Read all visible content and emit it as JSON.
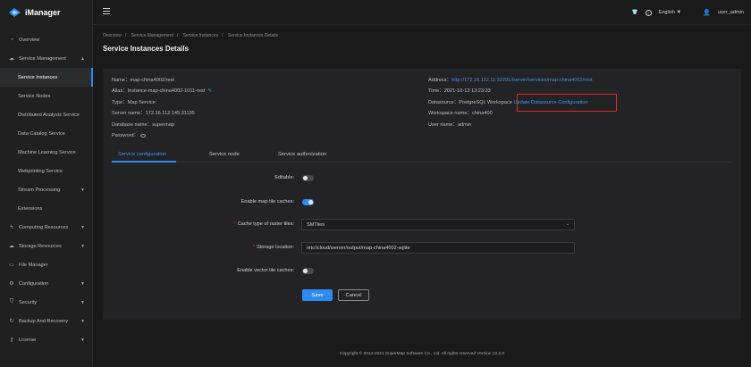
{
  "app": {
    "name": "iManager",
    "brand_color": "#2d8cf0"
  },
  "sidebar": {
    "items": [
      {
        "label": "Overview",
        "icon": "gauge-icon"
      },
      {
        "label": "Service Management",
        "icon": "cloud-icon",
        "expanded": true
      },
      {
        "label": "Service Instances",
        "sub": true,
        "active": true
      },
      {
        "label": "Service Nodes",
        "sub": true
      },
      {
        "label": "Distributed Analysis Service",
        "sub": true
      },
      {
        "label": "Data Catalog Service",
        "sub": true
      },
      {
        "label": "Machine Learning Service",
        "sub": true
      },
      {
        "label": "Webprinting Service",
        "sub": true
      },
      {
        "label": "Stream Processing",
        "sub": true,
        "has_children": true
      },
      {
        "label": "Extensions",
        "sub": true
      },
      {
        "label": "Computing Resources",
        "icon": "bolt-icon",
        "has_children": true
      },
      {
        "label": "Storage Resources",
        "icon": "cloud-icon",
        "has_children": true
      },
      {
        "label": "File Manager",
        "icon": "folder-icon"
      },
      {
        "label": "Configuration",
        "icon": "gear-icon",
        "has_children": true
      },
      {
        "label": "Security",
        "icon": "shield-icon",
        "has_children": true
      },
      {
        "label": "Backup And Recovery",
        "icon": "refresh-icon",
        "has_children": true
      },
      {
        "label": "License",
        "icon": "key-icon",
        "has_children": true
      }
    ]
  },
  "topbar": {
    "language": "English",
    "username": "user_admin"
  },
  "breadcrumb": [
    "Overview",
    "Service Management",
    "Service Instances",
    "Service Instances Details"
  ],
  "page_title": "Service Instances Details",
  "details": {
    "name": "Name：map-china4002/rest",
    "alias": "Alias：Instance-map-china4002-1011-rest",
    "type": "Type：Map Service",
    "server": "Server name：172.16.112.145:31135",
    "database": "Database name：supermap",
    "password": "Password：",
    "address_label": "Address：",
    "address_link": "http://172.16.112.11:32291/iserver/services/map-china4002/rest",
    "time": "Time：2021-10-13 13:23:33",
    "datasource_label": "Datasource：PostgreSQL Workspace",
    "datasource_link": "Update Datasource Configuration",
    "workspace": "Workspace name：china400",
    "user": "User name：admin"
  },
  "tabs": [
    "Service configuration",
    "Service node",
    "Service authroization"
  ],
  "form": {
    "editable_label": "Editable:",
    "editable_on": false,
    "enable_cache_label": "Enable map tile caches:",
    "enable_cache_on": true,
    "cache_type_label": "Cache type of raster tiles:",
    "cache_type_value": "SMTiles",
    "storage_label": "Storage location:",
    "storage_value": "/etc/icloud/iserver/output/map-china4002-sqlite",
    "vector_label": "Enable vector tile caches:",
    "vector_on": false,
    "save_label": "Save",
    "cancel_label": "Cancel"
  },
  "footer": "Copyright © 2014-2021 SuperMap Software Co., Ltd. All rights reserved    Version 10.2.0"
}
